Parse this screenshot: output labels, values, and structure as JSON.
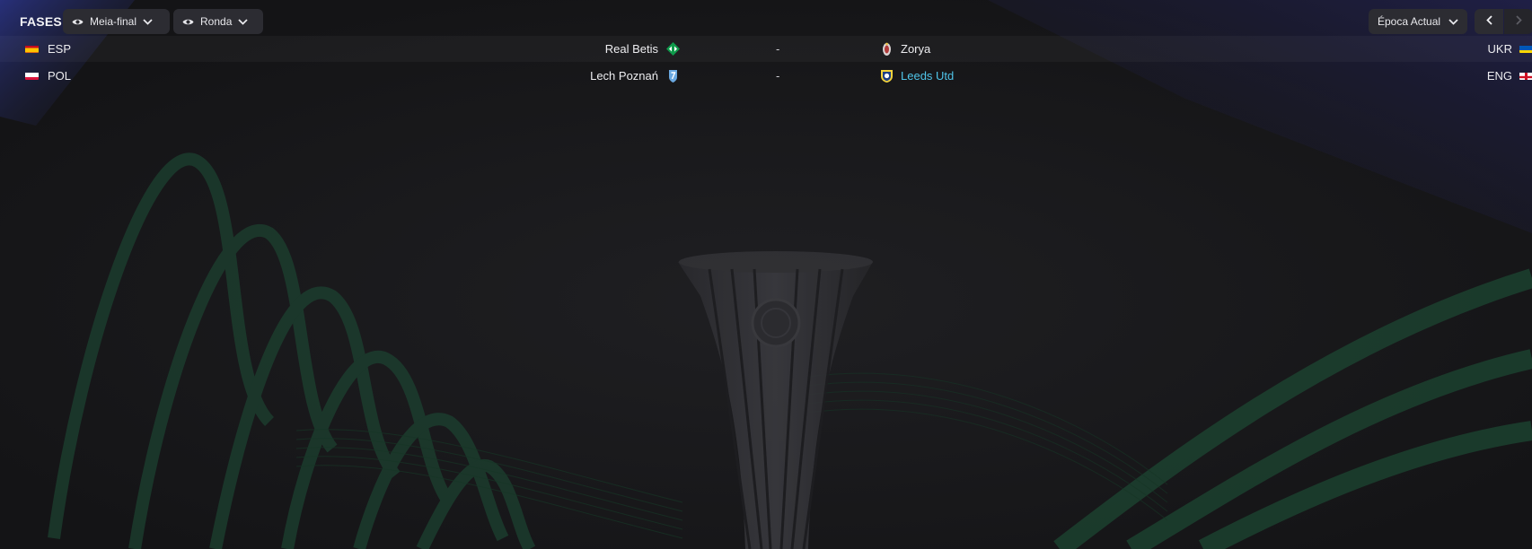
{
  "toolbar": {
    "stages_label": "FASES",
    "phase_dropdown": {
      "value": "Meia-final",
      "icon": "eye-icon"
    },
    "round_dropdown": {
      "value": "Ronda",
      "icon": "eye-icon"
    },
    "season_dropdown": {
      "value": "Época Actual"
    },
    "prev_icon": "chevron-left-icon",
    "next_icon": "chevron-right-icon"
  },
  "fixtures": [
    {
      "home_nation": "ESP",
      "home_team": "Real Betis",
      "score": "-",
      "away_team": "Zorya",
      "away_nation": "UKR"
    },
    {
      "home_nation": "POL",
      "home_team": "Lech Poznań",
      "score": "-",
      "away_team": "Leeds Utd",
      "away_nation": "ENG"
    }
  ],
  "colors": {
    "background": "#17171a",
    "button": "#2c2c32",
    "link": "#4fc4e8",
    "accent_green": "#1d4a34",
    "accent_blue": "#242a66"
  }
}
